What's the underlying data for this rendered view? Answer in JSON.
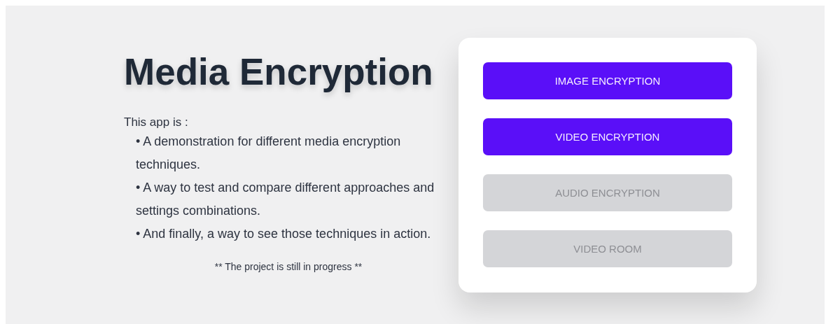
{
  "title": "Media Encryption",
  "intro": "This app is :",
  "points": [
    "• A demonstration for different media encryption techniques.",
    "• A way to test and compare different approaches and settings combinations.",
    "• And finally, a way to see those techniques in action."
  ],
  "note": "** The project is still in progress **",
  "buttons": [
    {
      "label": "IMAGE ENCRYPTION",
      "disabled": false
    },
    {
      "label": "VIDEO ENCRYPTION",
      "disabled": false
    },
    {
      "label": "AUDIO ENCRYPTION",
      "disabled": true
    },
    {
      "label": "VIDEO ROOM",
      "disabled": true
    }
  ]
}
